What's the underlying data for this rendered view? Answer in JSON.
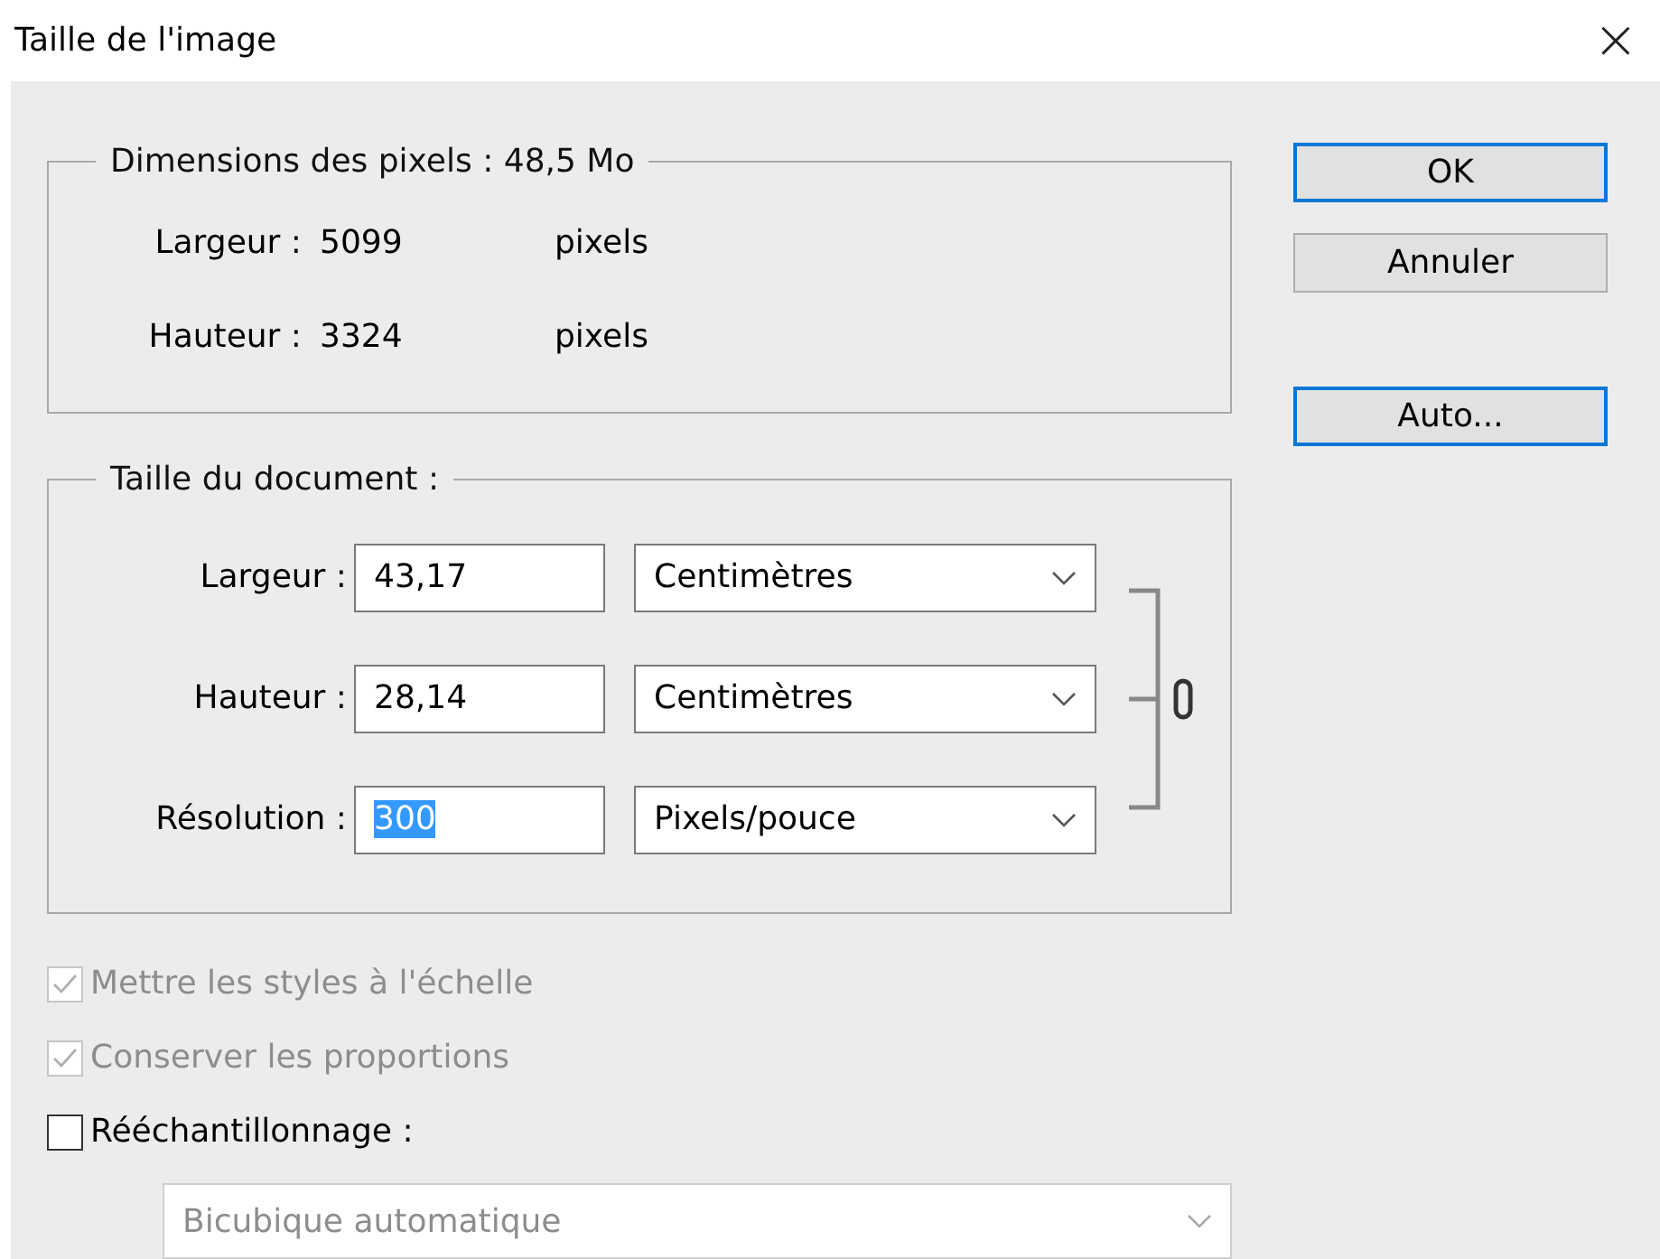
{
  "window": {
    "title": "Taille de l'image",
    "close": "×"
  },
  "pixel_group": {
    "title": "Dimensions des pixels : 48,5 Mo",
    "rows": [
      {
        "label": "Largeur :",
        "value": "5099",
        "unit": "pixels"
      },
      {
        "label": "Hauteur :",
        "value": "3324",
        "unit": "pixels"
      }
    ]
  },
  "document_group": {
    "title": "Taille du document :",
    "rows": [
      {
        "label": "Largeur :",
        "value": "43,17",
        "value_selected": false,
        "unit": "Centimètres"
      },
      {
        "label": "Hauteur :",
        "value": "28,14",
        "value_selected": false,
        "unit": "Centimètres"
      },
      {
        "label": "Résolution :",
        "value": "300",
        "value_selected": true,
        "unit": "Pixels/pouce"
      }
    ],
    "linked": true
  },
  "options": [
    {
      "label": "Mettre les styles à l'échelle",
      "checked": true,
      "disabled": true
    },
    {
      "label": "Conserver les proportions",
      "checked": true,
      "disabled": true
    },
    {
      "label": "Rééchantillonnage :",
      "checked": false,
      "disabled": false
    }
  ],
  "resample_select": {
    "value": "Bicubique automatique",
    "disabled": true
  },
  "buttons": [
    {
      "label": "OK",
      "highlighted": true
    },
    {
      "label": "Annuler",
      "highlighted": false
    },
    {
      "label": "Auto...",
      "highlighted": true
    }
  ]
}
